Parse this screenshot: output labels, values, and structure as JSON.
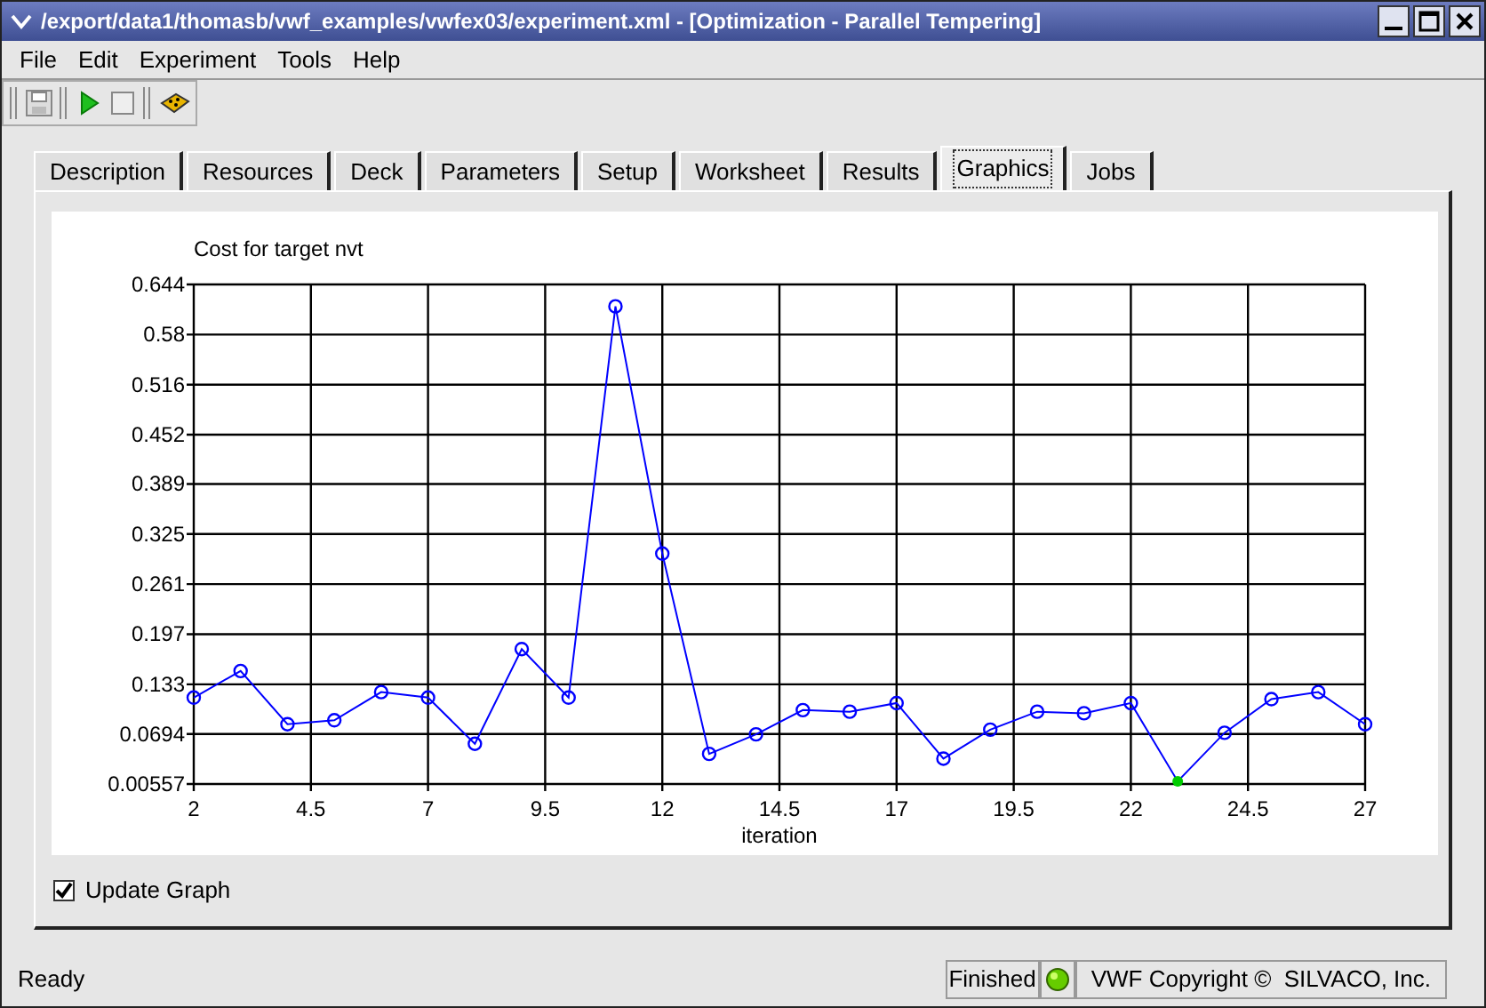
{
  "window": {
    "title": "/export/data1/thomasb/vwf_examples/vwfex03/experiment.xml - [Optimization - Parallel Tempering]"
  },
  "menu": [
    "File",
    "Edit",
    "Experiment",
    "Tools",
    "Help"
  ],
  "tabs": [
    {
      "label": "Description",
      "selected": false
    },
    {
      "label": "Resources",
      "selected": false
    },
    {
      "label": "Deck",
      "selected": false
    },
    {
      "label": "Parameters",
      "selected": false
    },
    {
      "label": "Setup",
      "selected": false
    },
    {
      "label": "Worksheet",
      "selected": false
    },
    {
      "label": "Results",
      "selected": false
    },
    {
      "label": "Graphics",
      "selected": true
    },
    {
      "label": "Jobs",
      "selected": false
    }
  ],
  "graphics": {
    "chart_data": {
      "type": "line",
      "title": "Cost for target nvt",
      "xlabel": "iteration",
      "x": [
        2,
        3,
        4,
        5,
        6,
        7,
        8,
        9,
        10,
        11,
        12,
        13,
        14,
        15,
        16,
        17,
        18,
        19,
        20,
        21,
        22,
        23,
        24,
        25,
        26,
        27
      ],
      "series": [
        {
          "color": "#0000ff",
          "marker": "circle",
          "values": [
            0.116,
            0.15,
            0.082,
            0.087,
            0.123,
            0.116,
            0.057,
            0.178,
            0.116,
            0.616,
            0.3,
            0.044,
            0.069,
            0.1,
            0.098,
            0.109,
            0.038,
            0.075,
            0.098,
            0.096,
            0.109,
            0.009,
            0.071,
            0.114,
            0.123,
            0.082
          ]
        }
      ],
      "xlim": [
        2,
        27
      ],
      "ylim": [
        0.00557,
        0.644
      ],
      "xticks": [
        2,
        4.5,
        7,
        9.5,
        12,
        14.5,
        17,
        19.5,
        22,
        24.5,
        27
      ],
      "yticks": [
        0.00557,
        0.0694,
        0.133,
        0.197,
        0.261,
        0.325,
        0.389,
        0.452,
        0.516,
        0.58,
        0.644
      ],
      "grid": true
    }
  },
  "update_graph": {
    "label": "Update Graph",
    "checked": true
  },
  "status_bar": {
    "message": "Ready",
    "state": "Finished",
    "copyright": "VWF Copyright ©  SILVACO, Inc."
  }
}
